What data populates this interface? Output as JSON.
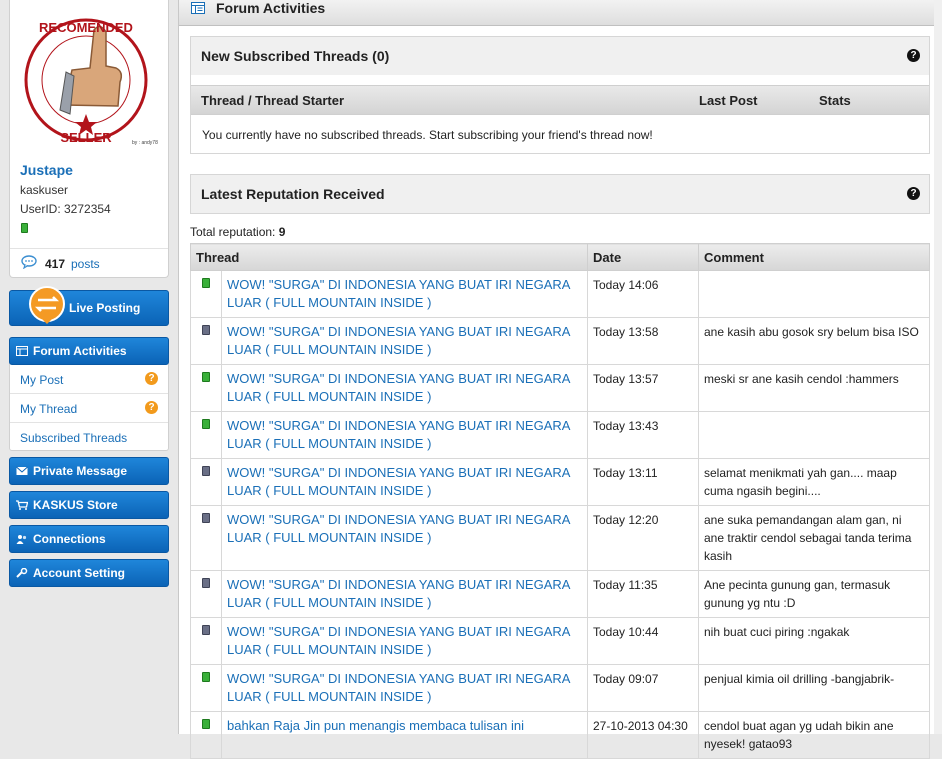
{
  "profile": {
    "avatar_alt": "RECOMENDED SELLER",
    "avatar_small_text": "by : andy78",
    "username": "Justape",
    "role": "kaskuser",
    "user_id": "UserID: 3272354",
    "post_count": "417",
    "post_label": "posts"
  },
  "sidebar": {
    "live_posting": "Live Posting",
    "forum_activities": {
      "title": "Forum Activities",
      "items": [
        {
          "label": "My Post",
          "badge": "?"
        },
        {
          "label": "My Thread",
          "badge": "?"
        },
        {
          "label": "Subscribed Threads"
        }
      ]
    },
    "private_message": "Private Message",
    "kaskus_store": "KASKUS Store",
    "connections": "Connections",
    "account_setting": "Account Setting"
  },
  "header": {
    "title": "Forum Activities"
  },
  "subscribed": {
    "title": "New Subscribed Threads (0)",
    "help": "?",
    "columns": [
      "Thread / Thread Starter",
      "Last Post",
      "Stats"
    ],
    "empty_message": "You currently have no subscribed threads. Start subscribing your friend's thread now!"
  },
  "reputation": {
    "title": "Latest Reputation Received",
    "help": "?",
    "total_label": "Total reputation:",
    "total_value": "9",
    "columns": [
      "Thread",
      "Date",
      "Comment"
    ],
    "colors": {
      "positive": "#3ab03a",
      "neutral": "#6a6f86"
    },
    "rows": [
      {
        "status": "green",
        "thread": "WOW! \"SURGA\" DI INDONESIA YANG BUAT IRI NEGARA LUAR ( FULL MOUNTAIN INSIDE )",
        "date": "Today 14:06",
        "comment": ""
      },
      {
        "status": "grey",
        "thread": "WOW! \"SURGA\" DI INDONESIA YANG BUAT IRI NEGARA LUAR ( FULL MOUNTAIN INSIDE )",
        "date": "Today 13:58",
        "comment": "ane kasih abu gosok sry belum bisa ISO"
      },
      {
        "status": "green",
        "thread": "WOW! \"SURGA\" DI INDONESIA YANG BUAT IRI NEGARA LUAR ( FULL MOUNTAIN INSIDE )",
        "date": "Today 13:57",
        "comment": "meski sr ane kasih cendol :hammers"
      },
      {
        "status": "green",
        "thread": "WOW! \"SURGA\" DI INDONESIA YANG BUAT IRI NEGARA LUAR ( FULL MOUNTAIN INSIDE )",
        "date": "Today 13:43",
        "comment": ""
      },
      {
        "status": "grey",
        "thread": "WOW! \"SURGA\" DI INDONESIA YANG BUAT IRI NEGARA LUAR ( FULL MOUNTAIN INSIDE )",
        "date": "Today 13:11",
        "comment": "selamat menikmati yah gan.... maap cuma ngasih begini...."
      },
      {
        "status": "grey",
        "thread": "WOW! \"SURGA\" DI INDONESIA YANG BUAT IRI NEGARA LUAR ( FULL MOUNTAIN INSIDE )",
        "date": "Today 12:20",
        "comment": "ane suka pemandangan alam gan, ni ane traktir cendol sebagai tanda terima kasih"
      },
      {
        "status": "grey",
        "thread": "WOW! \"SURGA\" DI INDONESIA YANG BUAT IRI NEGARA LUAR ( FULL MOUNTAIN INSIDE )",
        "date": "Today 11:35",
        "comment": "Ane pecinta gunung gan, termasuk gunung yg ntu :D"
      },
      {
        "status": "grey",
        "thread": "WOW! \"SURGA\" DI INDONESIA YANG BUAT IRI NEGARA LUAR ( FULL MOUNTAIN INSIDE )",
        "date": "Today 10:44",
        "comment": "nih buat cuci piring :ngakak"
      },
      {
        "status": "green",
        "thread": "WOW! \"SURGA\" DI INDONESIA YANG BUAT IRI NEGARA LUAR ( FULL MOUNTAIN INSIDE )",
        "date": "Today 09:07",
        "comment": "penjual kimia oil drilling -bangjabrik-"
      },
      {
        "status": "green",
        "thread": "bahkan Raja Jin pun menangis membaca tulisan ini",
        "date": "27-10-2013 04:30",
        "comment": "cendol buat agan yg udah bikin ane nyesek! gatao93"
      }
    ]
  }
}
